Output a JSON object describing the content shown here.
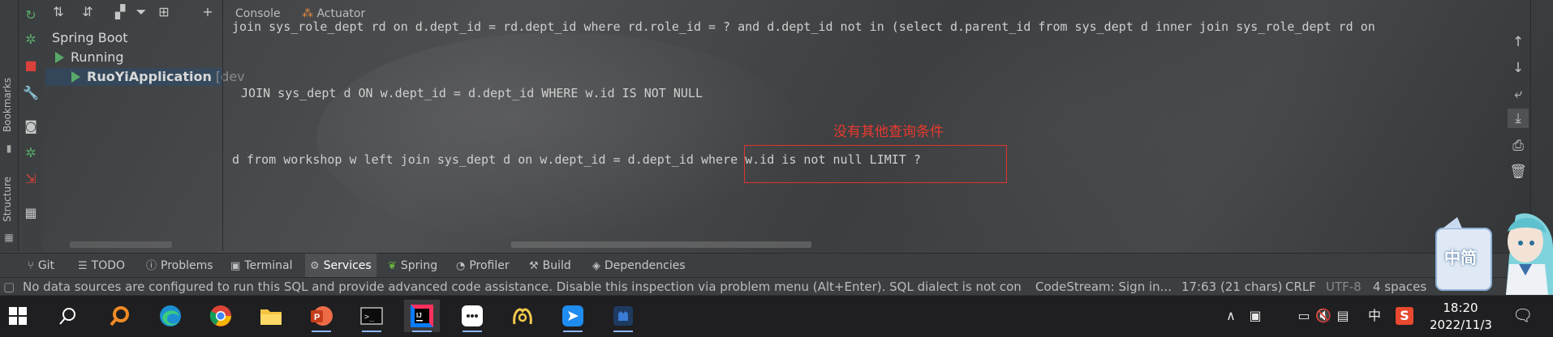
{
  "left_stripe": {
    "bookmarks_label": "Bookmarks",
    "structure_label": "Structure"
  },
  "console_tabs": {
    "console_label": "Console",
    "actuator_label": "Actuator"
  },
  "services_tree": {
    "root_label": "Spring Boot",
    "running_label": "Running",
    "app_label": "RuoYiApplication",
    "app_suffix": "[dev"
  },
  "console_lines": [
    "join sys_role_dept rd on d.dept_id = rd.dept_id where rd.role_id = ? and d.dept_id not in (select d.parent_id from sys_dept d inner join sys_role_dept rd on",
    " JOIN sys_dept d ON w.dept_id = d.dept_id WHERE w.id IS NOT NULL",
    "d from workshop w left join sys_dept d on w.dept_id = d.dept_id where w.id is not null LIMIT ?"
  ],
  "annotation": "没有其他查询条件",
  "tool_windows": [
    "Git",
    "TODO",
    "Problems",
    "Terminal",
    "Services",
    "Spring",
    "Profiler",
    "Build",
    "Dependencies"
  ],
  "active_tool_window": "Services",
  "status_bar": {
    "message": "No data sources are configured to run this SQL and provide advanced code assistance. Disable this inspection via problem menu (Alt+Enter). SQL dialect is not configu",
    "codestream": "CodeStream:  Sign in...",
    "position": "17:63 (21 chars)",
    "line_ending": "CRLF",
    "encoding": "UTF-8",
    "indent": "4 spaces"
  },
  "mascot_text": "中简",
  "taskbar": {
    "ime_label": "中",
    "clock_time": "18:20",
    "clock_date": "2022/11/3"
  },
  "colors": {
    "annotation_red": "#e8392f",
    "running_green": "#59a869",
    "console_text": "#cfcfcf"
  }
}
